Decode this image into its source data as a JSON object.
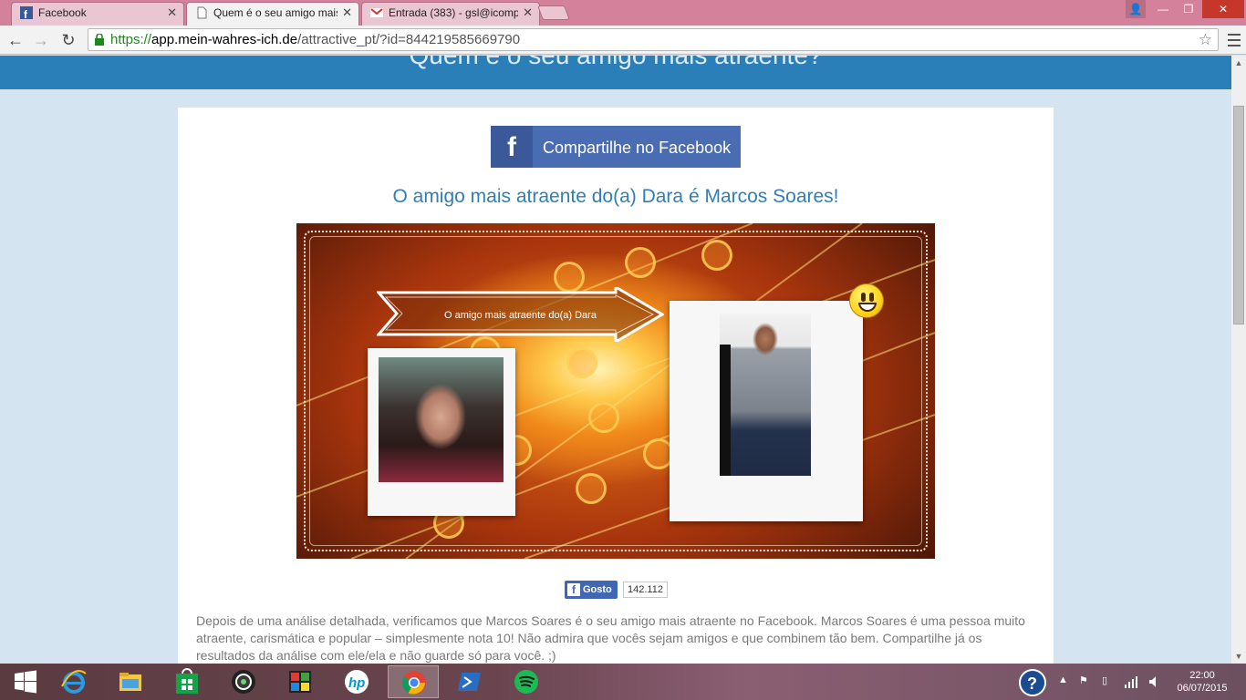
{
  "browser": {
    "tabs": [
      {
        "label": "Facebook",
        "active": false
      },
      {
        "label": "Quem é o seu amigo mais",
        "active": true
      },
      {
        "label": "Entrada (383) - gsl@icomp",
        "active": false
      }
    ],
    "url": {
      "scheme": "https://",
      "host": "app.mein-wahres-ich.de",
      "path": "/attractive_pt/?id=844219585669790"
    }
  },
  "page": {
    "header_title": "Quem é o seu amigo mais atraente?",
    "share_button_label": "Compartilhe no Facebook",
    "result_heading": "O amigo mais atraente do(a) Dara é Marcos Soares!",
    "banner_label": "O amigo mais atraente do(a) Dara",
    "like_label": "Gosto",
    "like_count": "142.112",
    "description": "Depois de uma análise detalhada, verificamos que Marcos Soares é o seu amigo mais atraente no Facebook. Marcos Soares é uma pessoa muito atraente, carismática e popular – simplesmente nota 10! Não admira que vocês sejam amigos e que combinem tão bem. Compartilhe já os resultados da análise com ele/ela e não guarde só para você. ;)"
  },
  "taskbar": {
    "apps": [
      "start",
      "internet-explorer",
      "file-explorer",
      "windows-store",
      "media-app",
      "paint-app",
      "hp-app",
      "chrome",
      "powershell",
      "spotify"
    ],
    "clock_time": "22:00",
    "clock_date": "06/07/2015"
  },
  "colors": {
    "header_band": "#2b7fb9",
    "facebook_blue": "#3b5998",
    "heading_blue": "#2f7fb6"
  }
}
